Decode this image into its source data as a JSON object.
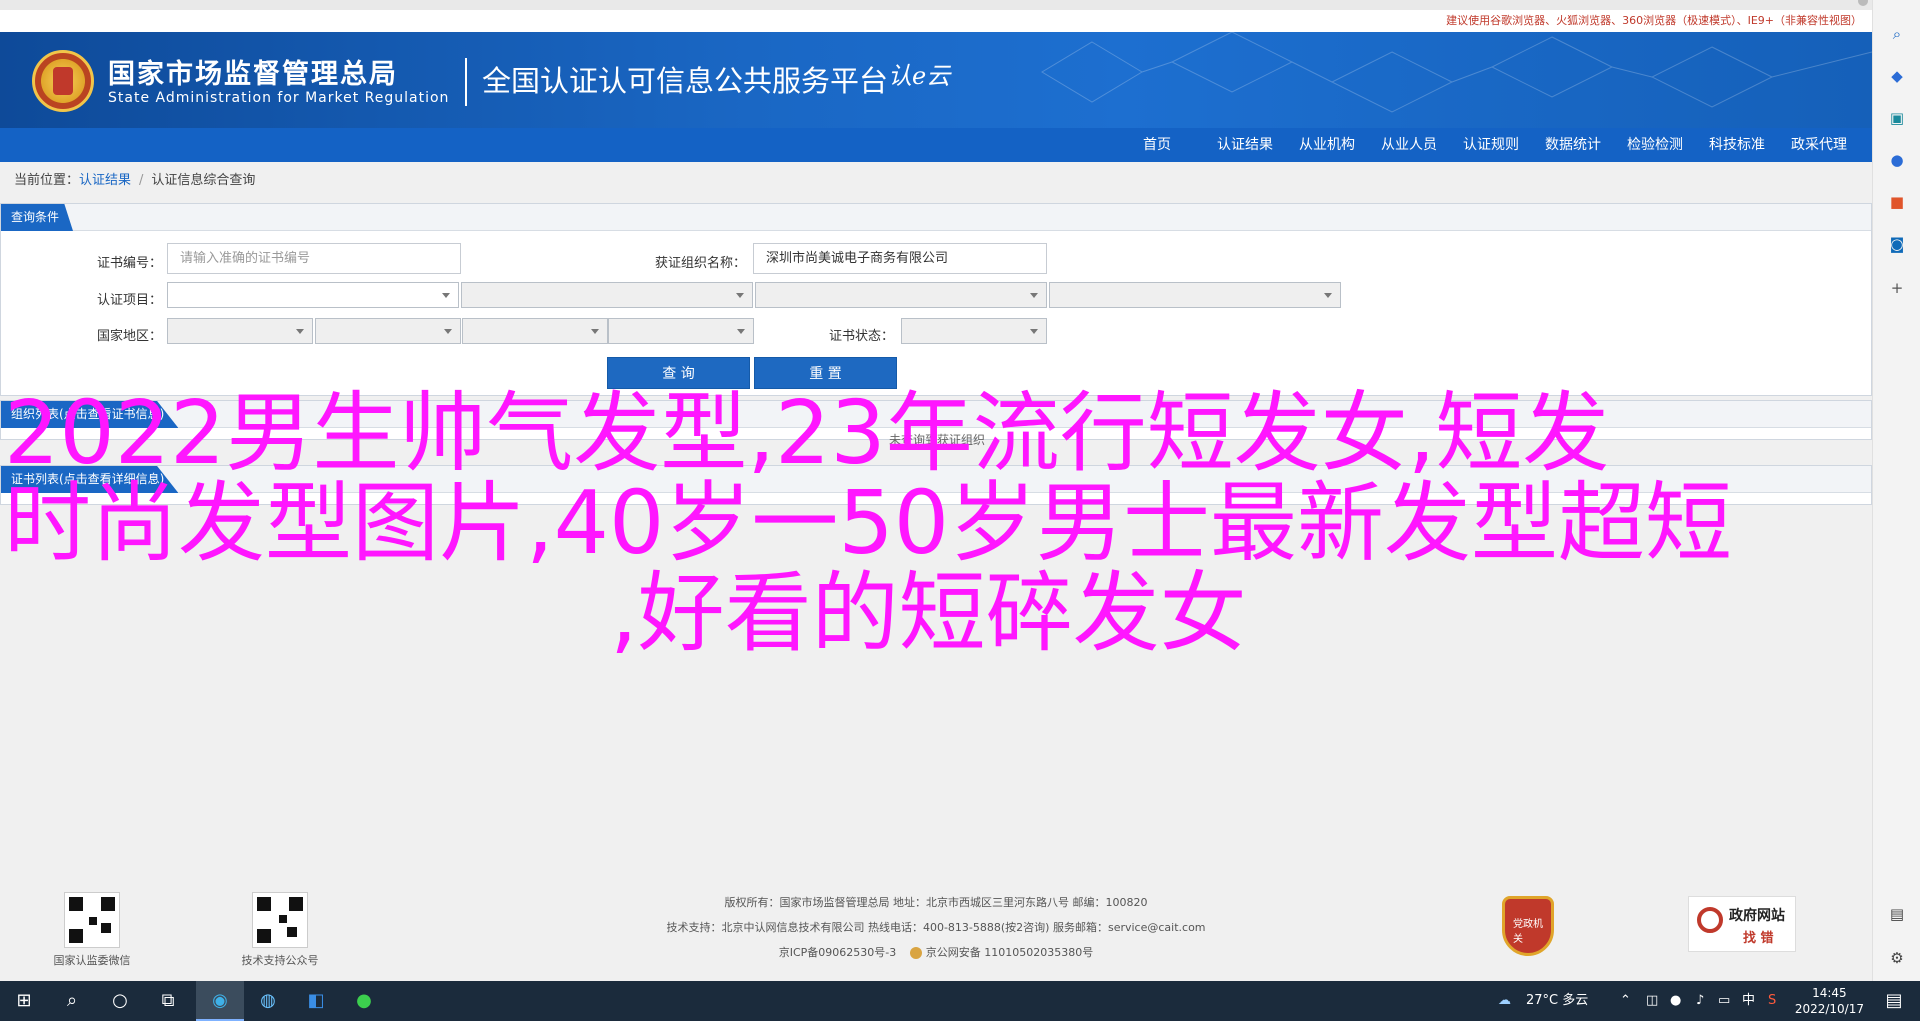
{
  "notice": "建议使用谷歌浏览器、火狐浏览器、360浏览器（极速模式）、IE9+（非兼容性视图）",
  "header": {
    "org_cn": "国家市场监督管理总局",
    "org_en": "State Administration  for  Market Regulation",
    "platform": "全国认证认可信息公共服务平台",
    "mark": "认e云"
  },
  "nav": [
    "首页",
    "认证结果",
    "从业机构",
    "从业人员",
    "认证规则",
    "数据统计",
    "检验检测",
    "科技标准",
    "政采代理"
  ],
  "breadcrumb": {
    "label": "当前位置：",
    "link": "认证结果",
    "sep": "/",
    "current": "认证信息综合查询"
  },
  "query": {
    "title": "查询条件",
    "cert_no_label": "证书编号：",
    "cert_no_placeholder": "请输入准确的证书编号",
    "org_name_label": "获证组织名称：",
    "org_name_value": "深圳市尚美诚电子商务有限公司",
    "cert_item_label": "认证项目：",
    "region_label": "国家地区：",
    "status_label": "证书状态：",
    "search_button": "查  询",
    "reset_button": "重  置"
  },
  "org_panel": {
    "title": "组织列表(点击查看证书信息)",
    "empty_text": "未查询到获证组织"
  },
  "list_panel": {
    "title": "证书列表(点击查看详细信息)"
  },
  "overlay": [
    "2022男生帅气发型,23年流行短发女,短发",
    "时尚发型图片,40岁一50岁男士最新发型超短",
    ",好看的短碎发女"
  ],
  "footer": {
    "qr1_label": "国家认监委微信",
    "qr2_label": "技术支持公众号",
    "line1": "版权所有：国家市场监督管理总局    地址：北京市西城区三里河东路八号    邮编：100820",
    "line2": "技术支持：北京中认网信息技术有限公司    热线电话：400-813-5888(按2咨询)    服务邮箱：service@cait.com",
    "line3a": "京ICP备09062530号-3",
    "line3b": "京公网安备 11010502035380号",
    "party_badge": "党政机关",
    "gov_badge_1": "政府网站",
    "gov_badge_2": "找 错"
  },
  "taskbar": {
    "weather": "27°C  多云",
    "ime": "中",
    "time": "14:45",
    "date": "2022/10/17"
  },
  "colors": {
    "brand_blue": "#1a67c4",
    "overlay_magenta": "#ff16ff",
    "notice_red": "#c0392b"
  }
}
